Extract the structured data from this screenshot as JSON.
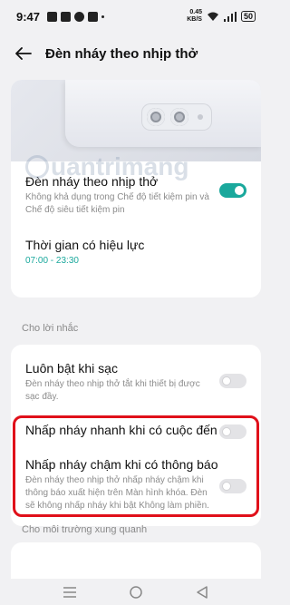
{
  "status_bar": {
    "time": "9:47",
    "speed_value": "0.45",
    "speed_unit": "KB/S",
    "battery": "50"
  },
  "header": {
    "title": "Đèn nháy theo nhịp thở"
  },
  "watermark": "uantrimang",
  "settings": {
    "main_toggle": {
      "title": "Đèn nháy theo nhịp thở",
      "desc": "Không khả dụng trong Chế độ tiết kiệm pin và Chế độ siêu tiết kiệm pin",
      "state": "on"
    },
    "effective_time": {
      "title": "Thời gian có hiệu lực",
      "value": "07:00 - 23:30"
    }
  },
  "section_reminders": {
    "label": "Cho lời nhắc",
    "items": [
      {
        "title": "Luôn bật khi sạc",
        "desc": "Đèn nháy theo nhịp thở tắt khi thiết bị được sạc đầy.",
        "state": "off"
      },
      {
        "title": "Nhấp nháy nhanh khi có cuộc đến",
        "desc": "",
        "state": "off"
      },
      {
        "title": "Nhấp nháy chậm khi có thông báo",
        "desc": "Đèn nháy theo nhịp thở nhấp nháy chậm khi thông báo xuất hiện trên Màn hình khóa. Đèn sẽ không nhấp nháy khi bật Không làm phiền.",
        "state": "off"
      }
    ]
  },
  "section_environment": {
    "label": "Cho môi trường xung quanh"
  },
  "colors": {
    "accent": "#1aa89c",
    "highlight": "#e0101a",
    "background": "#f1f1f3"
  },
  "nav": {
    "icons": [
      "menu-icon",
      "home-icon",
      "back-triangle-icon"
    ]
  }
}
